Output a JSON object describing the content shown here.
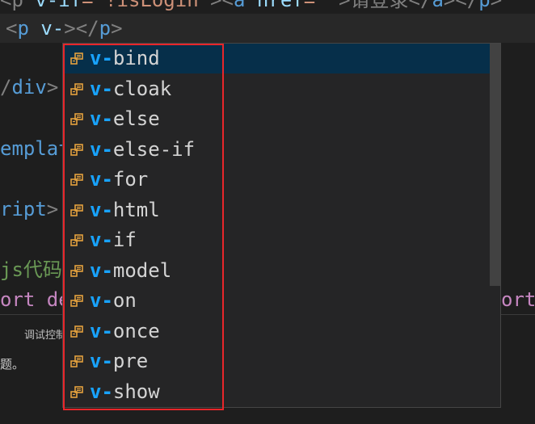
{
  "editor": {
    "lines": [
      {
        "parts": [
          {
            "text": "<p ",
            "cls": "punct"
          },
          {
            "text": "v-if",
            "cls": "attr"
          },
          {
            "text": "=\"!isLogin\"",
            "cls": "str"
          },
          {
            "text": "><",
            "cls": "punct"
          },
          {
            "text": "a",
            "cls": "tag"
          },
          {
            "text": " href",
            "cls": "attr"
          },
          {
            "text": "=\"\"",
            "cls": "str"
          },
          {
            "text": ">请登录</",
            "cls": "punct"
          },
          {
            "text": "a",
            "cls": "tag"
          },
          {
            "text": "></",
            "cls": "punct"
          },
          {
            "text": "p",
            "cls": "tag"
          },
          {
            "text": ">",
            "cls": "punct"
          }
        ]
      },
      {
        "parts": [
          {
            "text": "<",
            "cls": "punct"
          },
          {
            "text": "p",
            "cls": "tag"
          },
          {
            "text": " v-",
            "cls": "attr"
          },
          {
            "text": "></",
            "cls": "punct"
          },
          {
            "text": "p",
            "cls": "tag"
          },
          {
            "text": ">",
            "cls": "punct"
          }
        ]
      },
      {
        "parts": [
          {
            "text": "/",
            "cls": "punct"
          },
          {
            "text": "div",
            "cls": "tag"
          },
          {
            "text": ">",
            "cls": "punct"
          }
        ]
      },
      {
        "parts": [
          {
            "text": "emplat",
            "cls": "tag"
          }
        ]
      },
      {
        "parts": [
          {
            "text": "ript",
            "cls": "tag"
          },
          {
            "text": ">",
            "cls": "punct"
          }
        ]
      },
      {
        "parts": [
          {
            "text": "js代码",
            "cls": "comment"
          }
        ]
      },
      {
        "parts": [
          {
            "text": "ort de",
            "cls": "kw"
          }
        ]
      },
      {
        "parts": [
          {
            "text": "ort",
            "cls": "kw"
          }
        ]
      }
    ]
  },
  "panel": {
    "tab_label": "调试控制",
    "message": "题。"
  },
  "suggestions": {
    "prefix": "v-",
    "items": [
      {
        "label": "bind"
      },
      {
        "label": "cloak"
      },
      {
        "label": "else"
      },
      {
        "label": "else-if"
      },
      {
        "label": "for"
      },
      {
        "label": "html"
      },
      {
        "label": "if"
      },
      {
        "label": "model"
      },
      {
        "label": "on"
      },
      {
        "label": "once"
      },
      {
        "label": "pre"
      },
      {
        "label": "show"
      }
    ],
    "selected_index": 0
  },
  "colors": {
    "annotation_box": "#e8262a",
    "selected_item": "#062f4a",
    "prefix_highlight": "#18a3ff",
    "icon": "#e5a23e"
  }
}
